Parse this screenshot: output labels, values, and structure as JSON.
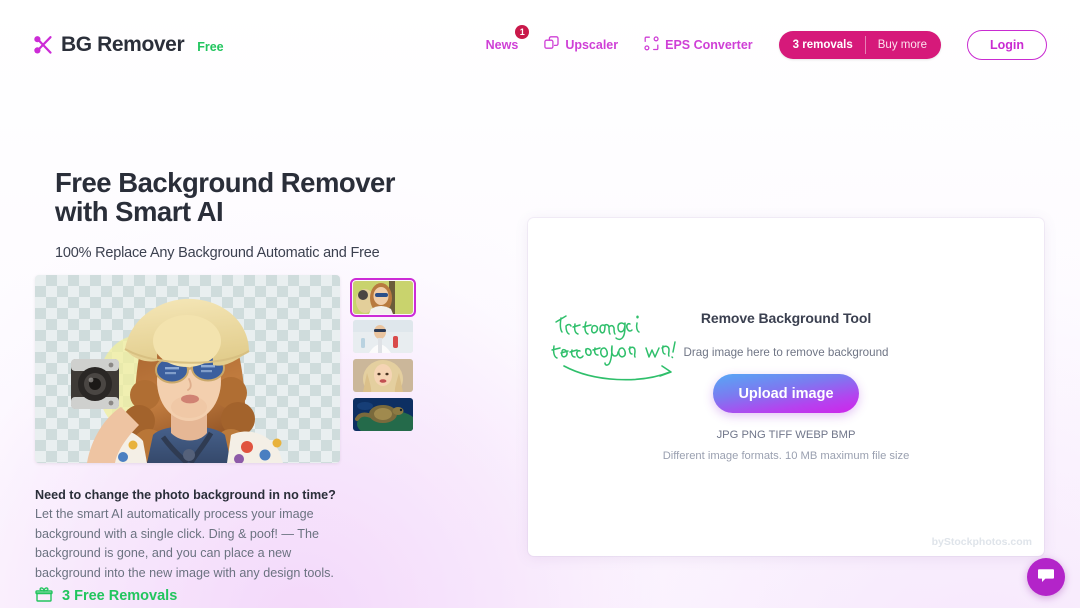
{
  "brand": {
    "icon": "scissors-icon",
    "name": "BG Remover",
    "tag": "Free"
  },
  "nav": {
    "items": [
      {
        "label": "News",
        "icon": "news-link",
        "badge": "1"
      },
      {
        "label": "Upscaler",
        "icon": "upscale-icon",
        "badge": null
      },
      {
        "label": "EPS Converter",
        "icon": "eps-convert-icon",
        "badge": null
      }
    ],
    "removals_count": "3 removals",
    "buy_more": "Buy more",
    "login": "Login"
  },
  "hero": {
    "title_line1": "Free Background Remover",
    "title_line2": "with Smart AI",
    "subtitle": "100% Replace Any Background Automatic and Free",
    "blurb_bold": "Need to change the photo background in no time?",
    "blurb_rest": " Let the smart AI automatically process your image background with a single click. Ding & poof! — The background is gone, and you can place a new background into the new image with any design tools.",
    "free_removals": "3 Free Removals",
    "free_removals_icon": "gift-box-icon",
    "thumbnails": [
      {
        "name": "thumbnail-woman-camera",
        "selected": true
      },
      {
        "name": "thumbnail-scientist",
        "selected": false
      },
      {
        "name": "thumbnail-blonde-portrait",
        "selected": false
      },
      {
        "name": "thumbnail-sea-turtle",
        "selected": false
      }
    ]
  },
  "upload_panel": {
    "magic_note_line1": "Try the magic",
    "magic_note_line2": "technology now!",
    "title": "Remove Background Tool",
    "drag_text": "Drag image here to remove background",
    "upload_button": "Upload image",
    "formats": "JPG PNG TIFF WEBP BMP",
    "limits": "Different image formats. 10 MB maximum file size",
    "credit": "byStockphotos.com"
  },
  "chat": {
    "icon": "chat-bubble-icon"
  },
  "colors": {
    "brand_magenta": "#cc2bd6",
    "pink_pill": "#d6197a",
    "green": "#22c55e",
    "badge_red": "#c9184a",
    "text_dark": "#2a2e39",
    "text_muted": "#6b7280"
  }
}
